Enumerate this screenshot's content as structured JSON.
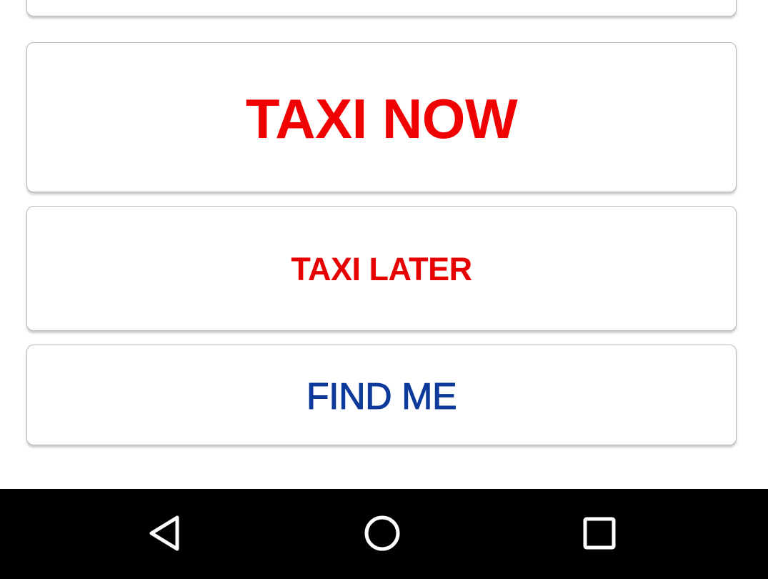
{
  "buttons": {
    "taxi_now": {
      "label": "TAXI NOW",
      "color": "#f00000"
    },
    "taxi_later": {
      "label": "TAXI LATER",
      "color": "#e80000"
    },
    "find_me": {
      "label": "FIND ME",
      "color": "#0d3a9a"
    }
  },
  "navigation_bar": {
    "background": "#000000",
    "icon_color": "#ffffff",
    "icons": [
      "back-icon",
      "home-icon",
      "recent-apps-icon"
    ]
  }
}
